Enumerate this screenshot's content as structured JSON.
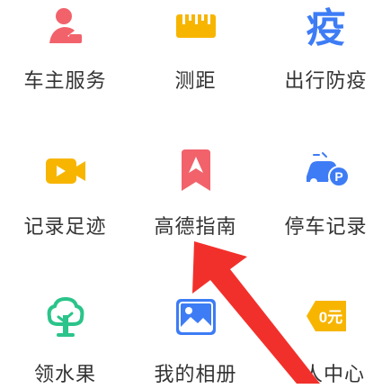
{
  "grid": {
    "items": [
      {
        "label": "车主服务",
        "icon": "car-owner-service-icon",
        "color": "#f2626b"
      },
      {
        "label": "测距",
        "icon": "ruler-icon",
        "color": "#f7b500"
      },
      {
        "label": "出行防疫",
        "icon": "epidemic-prevention-icon",
        "color": "#3d7cf5"
      },
      {
        "label": "记录足迹",
        "icon": "video-camera-icon",
        "color": "#f7b500"
      },
      {
        "label": "高德指南",
        "icon": "bookmark-guide-icon",
        "color": "#f2626b"
      },
      {
        "label": "停车记录",
        "icon": "parking-car-icon",
        "color": "#3d7cf5"
      },
      {
        "label": "领水果",
        "icon": "tree-icon",
        "color": "#2bc48a"
      },
      {
        "label": "我的相册",
        "icon": "photo-album-icon",
        "color": "#3d7cf5"
      },
      {
        "label": "人中心",
        "icon": "wallet-zero-yuan-icon",
        "color": "#f7b500",
        "icon_text": "0元"
      }
    ],
    "epidemic_glyph": "疫"
  },
  "annotation": {
    "type": "pointer-arrow",
    "color": "#f2302b"
  }
}
